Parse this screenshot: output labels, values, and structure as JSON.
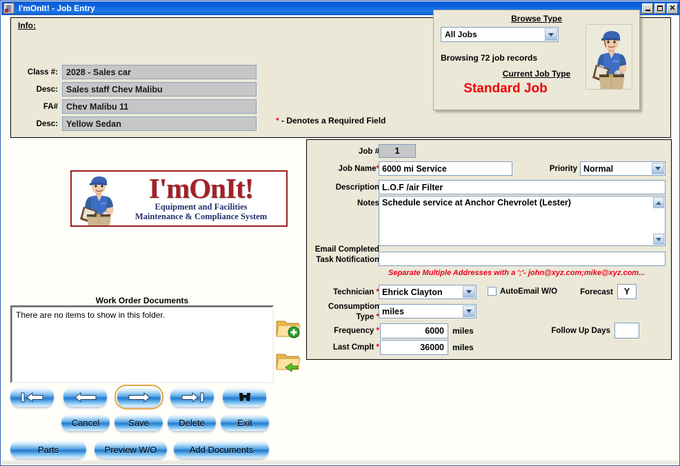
{
  "window": {
    "title": "I'mOnIt! - Job Entry",
    "icon": "app-icon",
    "minimize_label": "_",
    "maximize_label": "□",
    "close_label": "✕"
  },
  "info": {
    "section_label": "Info:",
    "fields": [
      {
        "label": "Class #:",
        "value": "2028 - Sales car"
      },
      {
        "label": "Desc:",
        "value": "Sales staff Chev Malibu"
      },
      {
        "label": "FA#",
        "value": "Chev Malibu 11"
      },
      {
        "label": "Desc:",
        "value": "Yellow Sedan"
      }
    ],
    "required_note_asterisk": "*",
    "required_note": " - Denotes a Required Field"
  },
  "browse": {
    "title": "Browse Type",
    "selected": "All Jobs",
    "count_text": "Browsing 72 job records",
    "current_job_type_title": "Current Job Type",
    "current_job_type": "Standard Job",
    "accent_color": "#ee0000"
  },
  "logo": {
    "main": "I'mOnIt!",
    "sub1": "Equipment and Facilities",
    "sub2": "Maintenance & Compliance System",
    "brand_color": "#a32028",
    "sub_color": "#22306a"
  },
  "documents": {
    "title": "Work Order Documents",
    "empty_text": "There are no items to show in this folder.",
    "add_folder_icon": "add-folder-icon",
    "open_folder_icon": "open-folder-icon"
  },
  "form": {
    "job_number_label": "Job #",
    "job_number_value": "1",
    "job_name_label": "Job Name",
    "job_name_value": "6000 mi Service",
    "priority_label": "Priority",
    "priority_value": "Normal",
    "description_label": "Description",
    "description_value": "L.O.F /air Filter",
    "notes_label": "Notes",
    "notes_value": "Schedule service at Anchor Chevrolet (Lester)",
    "email_label": "Email Completed Task Notification",
    "email_value": "",
    "email_hint": "Separate Multiple Addresses with a ';'- john@xyz.com;mike@xyz.com...",
    "technician_label": "Technician",
    "technician_value": "Ehrick Clayton",
    "autoemail_label": "AutoEmail W/O",
    "autoemail_checked": false,
    "forecast_label": "Forecast",
    "forecast_value": "Y",
    "consumption_label": "Consumption Type",
    "consumption_value": "miles",
    "frequency_label": "Frequency",
    "frequency_value": "6000",
    "frequency_unit": "miles",
    "last_cmplt_label": "Last Cmplt",
    "last_cmplt_value": "36000",
    "last_cmplt_unit": "miles",
    "followup_label": "Follow Up Days",
    "followup_value": "",
    "required_mark": "*"
  },
  "nav_buttons": [
    {
      "name": "first-record",
      "icon": "first-record-icon"
    },
    {
      "name": "previous-record",
      "icon": "previous-record-icon"
    },
    {
      "name": "next-record",
      "icon": "next-record-icon"
    },
    {
      "name": "last-record",
      "icon": "last-record-icon"
    },
    {
      "name": "find-record",
      "icon": "binoculars-icon"
    }
  ],
  "action_buttons": {
    "cancel": "Cancel",
    "save": "Save",
    "delete": "Delete",
    "exit": "Exit"
  },
  "footer_buttons": {
    "parts": "Parts",
    "preview_wo": "Preview W/O",
    "add_documents": "Add Documents"
  }
}
